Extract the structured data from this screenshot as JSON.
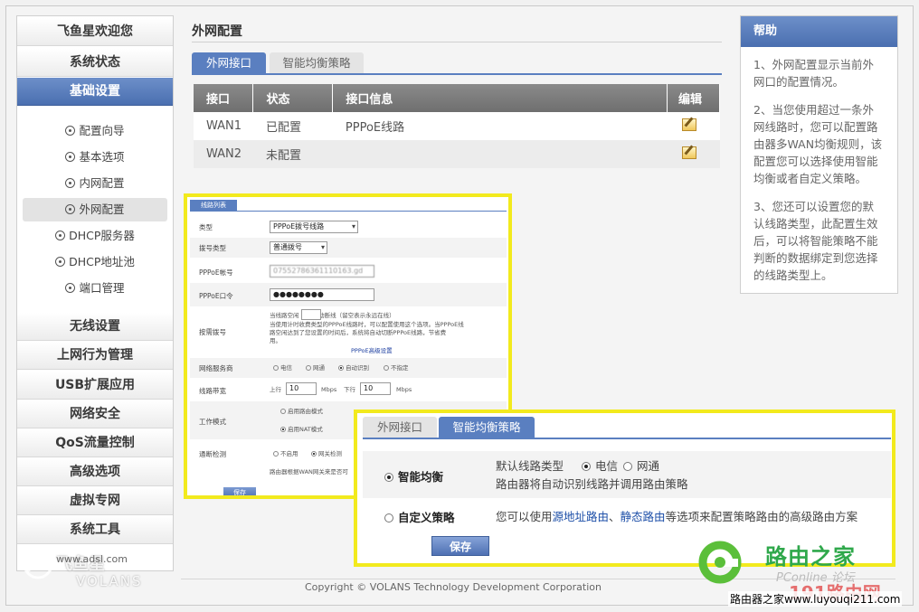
{
  "nav": {
    "items": [
      {
        "label": "飞鱼星欢迎您",
        "active": false
      },
      {
        "label": "系统状态",
        "active": false
      },
      {
        "label": "基础设置",
        "active": true
      }
    ],
    "sub_items": [
      {
        "label": "配置向导",
        "active": false
      },
      {
        "label": "基本选项",
        "active": false
      },
      {
        "label": "内网配置",
        "active": false
      },
      {
        "label": "外网配置",
        "active": true
      },
      {
        "label": "DHCP服务器",
        "active": false
      },
      {
        "label": "DHCP地址池",
        "active": false
      },
      {
        "label": "端口管理",
        "active": false
      }
    ],
    "bottom_items": [
      {
        "label": "无线设置"
      },
      {
        "label": "上网行为管理"
      },
      {
        "label": "USB扩展应用"
      },
      {
        "label": "网络安全"
      },
      {
        "label": "QoS流量控制"
      },
      {
        "label": "高级选项"
      },
      {
        "label": "虚拟专网"
      },
      {
        "label": "系统工具"
      }
    ],
    "logo_text": "飞鱼星",
    "logo_sub": "VOLANS",
    "logo_url": "www.adsl.com"
  },
  "main": {
    "title": "外网配置",
    "tabs": [
      {
        "label": "外网接口",
        "active": true
      },
      {
        "label": "智能均衡策略",
        "active": false
      }
    ],
    "table": {
      "headers": [
        "接口",
        "状态",
        "接口信息",
        "编辑"
      ],
      "rows": [
        {
          "iface": "WAN1",
          "status": "已配置",
          "info": "PPPoE线路"
        },
        {
          "iface": "WAN2",
          "status": "未配置",
          "info": ""
        }
      ]
    }
  },
  "help": {
    "title": "帮助",
    "paragraphs": [
      "1、外网配置显示当前外网口的配置情况。",
      "2、当您使用超过一条外网线路时，您可以配置路由器多WAN均衡规则，该配置您可以选择使用智能均衡或者自定义策略。",
      "3、您还可以设置您的默认线路类型，此配置生效后，可以将智能策略不能判断的数据绑定到您选择的线路类型上。"
    ]
  },
  "config_form": {
    "tab_label": "线路列表",
    "type_label": "类型",
    "type_value": "PPPoE拨号线路",
    "dial_type_label": "拨号类型",
    "dial_type_value": "普通拨号",
    "account_label": "PPPoE帐号",
    "account_value": "07552786361110163.gd",
    "password_label": "PPPoE口令",
    "password_value": "●●●●●●●●",
    "ondemand_label": "按需拨号",
    "ondemand_line1": "当线路空闲        秒后自动断线（留空表示永远在线）",
    "ondemand_line2": "当使用计时收费类型的PPPoE线路时，可以配置使用这个选项。当PPPoE线",
    "ondemand_line3": "路空闲达到了您设置的时间后，系统将自动切断PPPoE线路，节省费",
    "ondemand_line4": "用。",
    "advanced_link": "PPPoE高级设置",
    "isp_label": "网络服务商",
    "isp_options": [
      "电信",
      "网通",
      "自动识别",
      "不指定"
    ],
    "isp_selected": "自动识别",
    "bandwidth_label": "线路带宽",
    "up_label": "上行",
    "up_value": "10",
    "down_label": "下行",
    "down_value": "10",
    "unit": "Mbps",
    "mode_label": "工作模式",
    "mode_options": [
      "启用路由模式",
      "启用NAT模式"
    ],
    "mode_selected": "启用NAT模式",
    "detect_label": "通断检测",
    "detect_options": [
      "不启用",
      "网关检测"
    ],
    "detect_selected": "网关检测",
    "detect_note": "路由器根据WAN网关来是否可",
    "save_label": "保存"
  },
  "balance_panel": {
    "tabs": [
      {
        "label": "外网接口",
        "active": false
      },
      {
        "label": "智能均衡策略",
        "active": true
      }
    ],
    "smart_label": "智能均衡",
    "default_line_label": "默认线路类型",
    "line_options": [
      "电信",
      "网通"
    ],
    "line_selected": "电信",
    "smart_desc": "路由器将自动识别线路并调用路由策略",
    "custom_label": "自定义策略",
    "custom_desc_prefix": "您可以使用",
    "link_source": "源地址路由",
    "custom_sep": "、",
    "link_static": "静态路由",
    "custom_desc_suffix": "等选项来配置策略路由的高级路由方案",
    "save_label": "保存",
    "selected": "智能均衡"
  },
  "footer": {
    "copyright": "Copyright © VOLANS Technology Development Corporation"
  },
  "watermark": {
    "title": "路由之家",
    "faint": "PConline   论坛",
    "red": "191路由网",
    "bottom": "路由器之家www.luyouqi211.com"
  },
  "colors": {
    "accent_blue": "#5a7fc0",
    "highlight_yellow": "#f2ea1d",
    "status_ok": "#2a8a2a",
    "status_pending": "#d08a00",
    "watermark_green": "#2fa84b"
  }
}
